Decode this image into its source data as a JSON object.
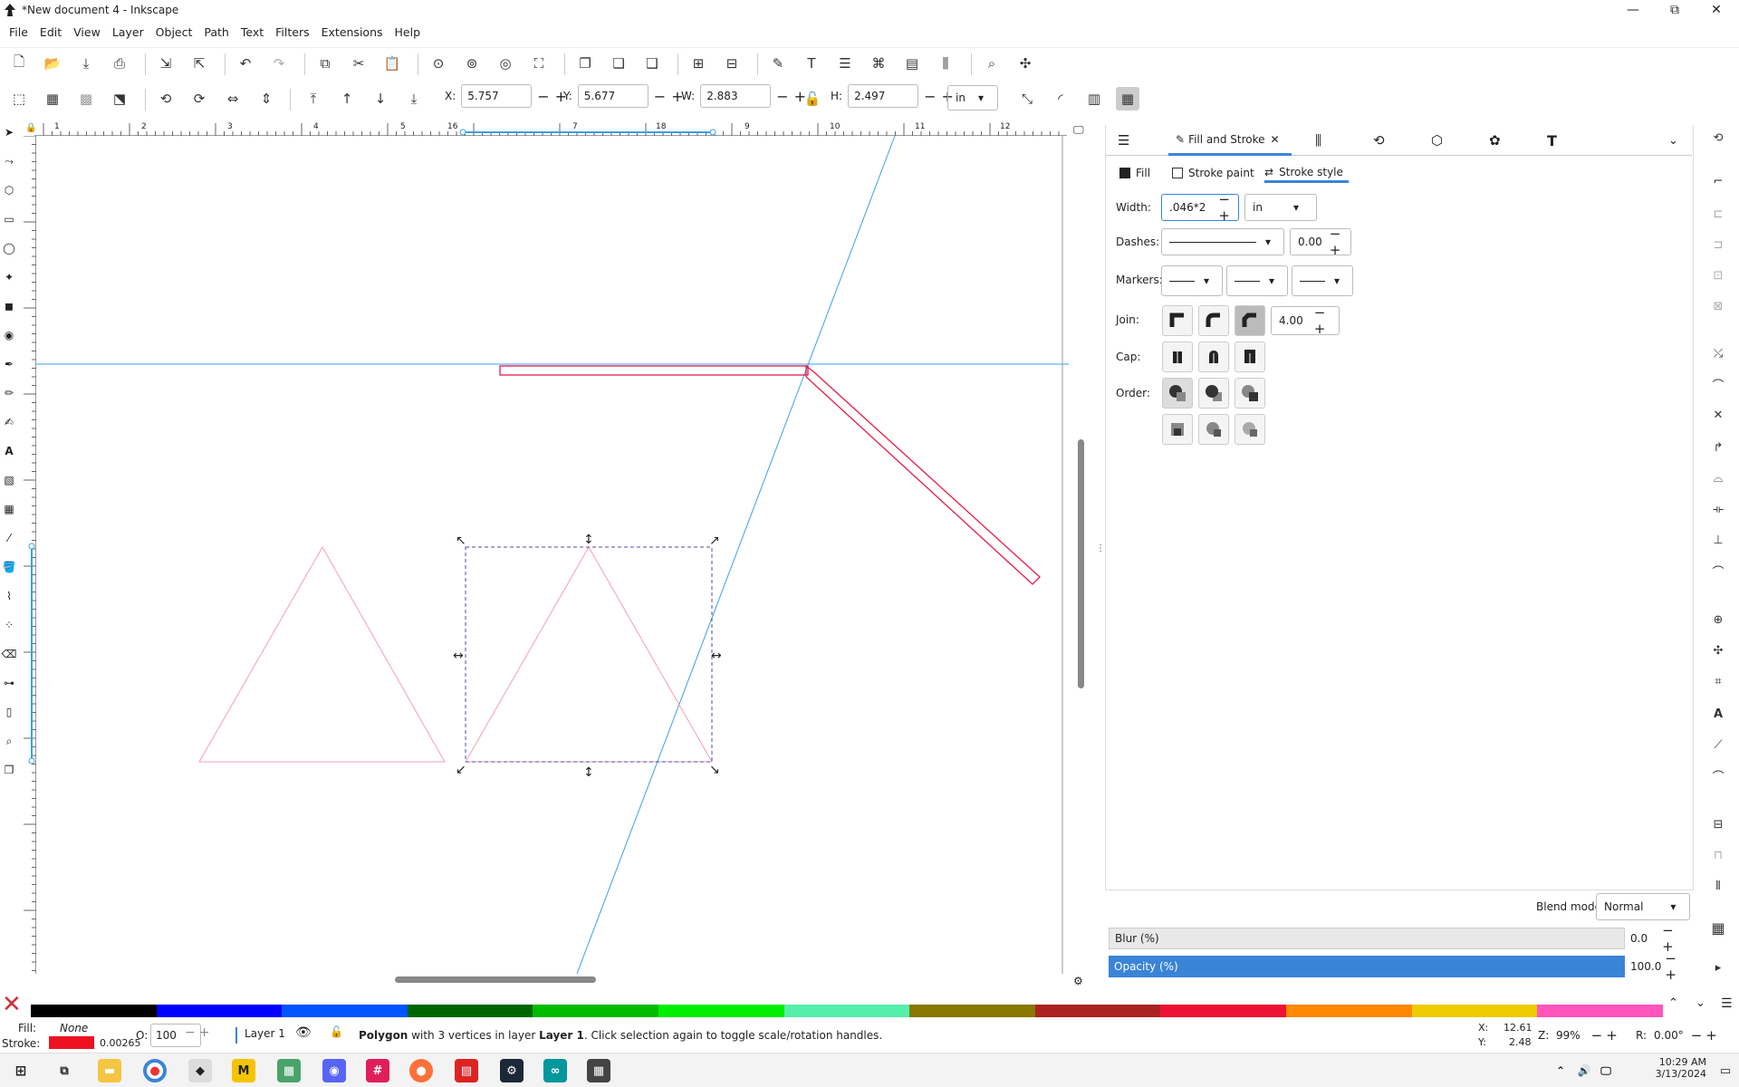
{
  "window": {
    "title": "*New document 4 - Inkscape",
    "controls": {
      "minimize": "—",
      "maximize": "⧉",
      "close": "✕"
    }
  },
  "menubar": [
    "File",
    "Edit",
    "View",
    "Layer",
    "Object",
    "Path",
    "Text",
    "Filters",
    "Extensions",
    "Help"
  ],
  "toolbar_select": {
    "x_label": "X:",
    "x_value": "5.757",
    "y_label": "Y:",
    "y_value": "5.677",
    "w_label": "W:",
    "w_value": "2.883",
    "h_label": "H:",
    "h_value": "2.497",
    "unit": "in"
  },
  "ruler_top_ticks": [
    "1",
    "2",
    "3",
    "4",
    "5",
    "16",
    "7",
    "18",
    "9",
    "10",
    "11",
    "12"
  ],
  "panel": {
    "tab_title": "Fill and Stroke",
    "subtabs": {
      "fill": "Fill",
      "stroke_paint": "Stroke paint",
      "stroke_style": "Stroke style"
    },
    "width_label": "Width:",
    "width_value": ".046*2",
    "width_unit": "in",
    "dashes_label": "Dashes:",
    "dashes_offset": "0.00",
    "markers_label": "Markers:",
    "join_label": "Join:",
    "miter_limit": "4.00",
    "cap_label": "Cap:",
    "order_label": "Order:",
    "blend_label": "Blend mode:",
    "blend_value": "Normal",
    "blur_label": "Blur (%)",
    "blur_value": "0.0",
    "opacity_label": "Opacity (%)",
    "opacity_value": "100.0"
  },
  "palette_colors": [
    "#000000",
    "#0000ff",
    "#0055ff",
    "#006600",
    "#00bb00",
    "#00ee00",
    "#55eeaa",
    "#887700",
    "#aa2222",
    "#ee1133",
    "#ff8800",
    "#eecc00",
    "#ff55bb"
  ],
  "statusbar": {
    "fill_label": "Fill:",
    "fill_value": "None",
    "stroke_label": "Stroke:",
    "stroke_width": "0.00265",
    "stroke_color": "#ee1122",
    "opacity_label": "O:",
    "opacity_value": "100",
    "layer": "Layer 1",
    "message_strong": "Polygon",
    "message_mid": " with 3 vertices in layer ",
    "message_layer": "Layer 1",
    "message_end": ". Click selection again to toggle scale/rotation handles.",
    "cursor_x_label": "X:",
    "cursor_x": "12.61",
    "cursor_y_label": "Y:",
    "cursor_y": "2.48",
    "zoom_label": "Z:",
    "zoom": "99%",
    "rotate_label": "R:",
    "rotate": "0.00°"
  },
  "taskbar": {
    "time": "10:29 AM",
    "date": "3/13/2024"
  }
}
